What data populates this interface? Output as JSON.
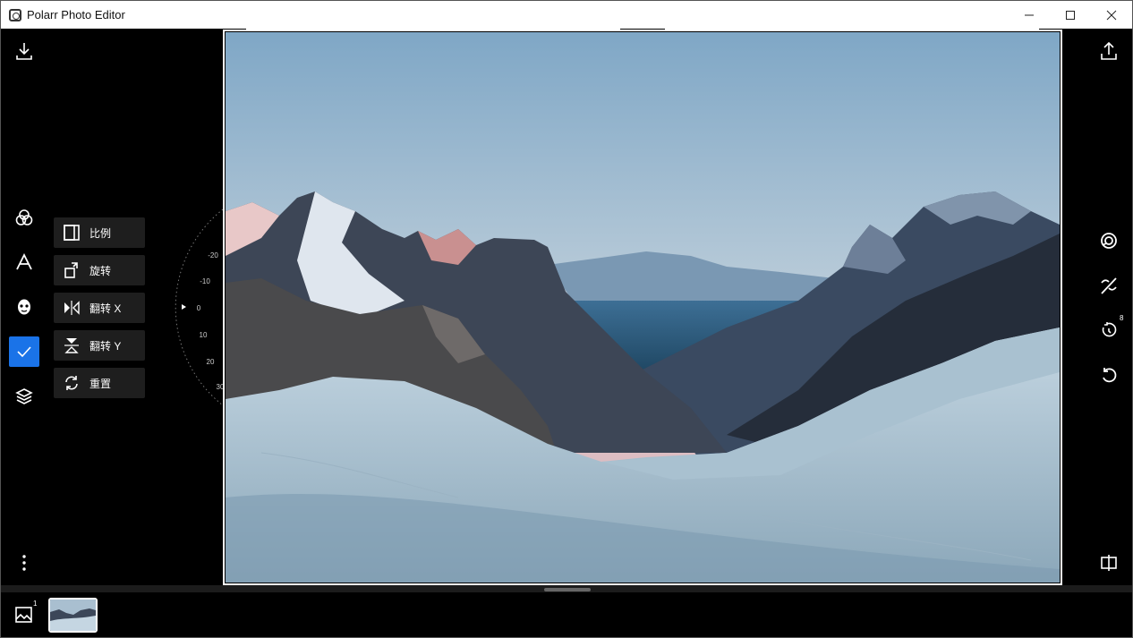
{
  "window": {
    "title": "Polarr Photo Editor",
    "controls": [
      "minimize-icon",
      "maximize-icon",
      "close-icon"
    ]
  },
  "left_toolbar": {
    "icons": [
      "download-icon",
      "filters-icon",
      "text-icon",
      "face-icon",
      "crop-check-icon",
      "layers-icon",
      "more-icon"
    ],
    "active": "crop-check-icon"
  },
  "crop_menu": {
    "items": [
      {
        "label": "比例",
        "icon": "aspect-ratio-icon"
      },
      {
        "label": "旋转",
        "icon": "rotate-icon"
      },
      {
        "label": "翻转 X",
        "icon": "flip-x-icon"
      },
      {
        "label": "翻转 Y",
        "icon": "flip-y-icon"
      },
      {
        "label": "重置",
        "icon": "reset-icon"
      }
    ]
  },
  "rotation_dial": {
    "ticks": [
      "-30",
      "-20",
      "-10",
      "0",
      "10",
      "20",
      "30"
    ],
    "current": 0
  },
  "right_toolbar": {
    "icons": [
      "export-icon",
      "auto-icon",
      "mask-toggle-icon",
      "history-icon",
      "undo-icon",
      "compare-icon"
    ],
    "history_count": "8"
  },
  "filmstrip": {
    "gallery_count": "1"
  },
  "colors": {
    "accent": "#1a73e8",
    "menu_bg": "#1e1e1e",
    "background": "#000000"
  }
}
